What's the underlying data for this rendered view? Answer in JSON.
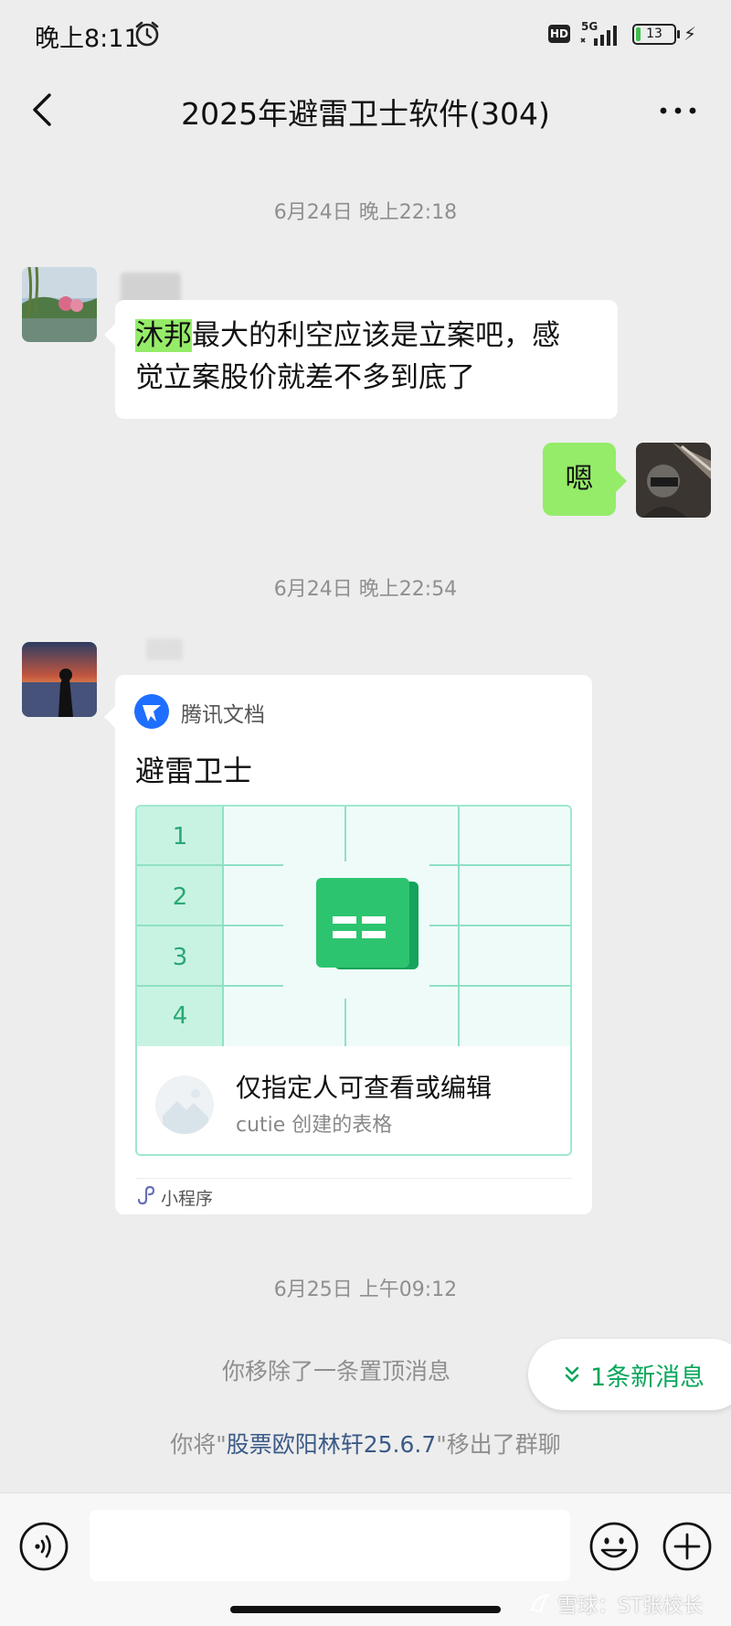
{
  "status_bar": {
    "time": "晚上8:11",
    "hd": "HD",
    "network": "5G",
    "battery_level": 13,
    "battery_text": "13"
  },
  "title_bar": {
    "title": "2025年避雷卫士软件(304)",
    "back_icon": "chevron-left-icon",
    "more_icon": "ellipsis-icon"
  },
  "messages": {
    "ts1": "6月24日 晚上22:18",
    "msg1": {
      "mention": "沐邦",
      "line1_rest": "最大的利空应该是立案吧，感",
      "line2": "觉立案股价就差不多到底了"
    },
    "msg2": {
      "text": "嗯"
    },
    "ts2": "6月24日 晚上22:54",
    "card": {
      "source": "腾讯文档",
      "title": "避雷卫士",
      "rows": [
        "1",
        "2",
        "3",
        "4"
      ],
      "access": "仅指定人可查看或编辑",
      "creator": "cutie 创建的表格",
      "footer": "小程序"
    },
    "ts3": "6月25日 上午09:12",
    "sys1": "你移除了一条置顶消息",
    "sys2": {
      "prefix": "你将\"",
      "name": "股票欧阳林轩25.6.7",
      "suffix": "\"移出了群聊"
    }
  },
  "new_messages_pill": "1条新消息",
  "input_bar": {
    "voice_icon": "voice-icon",
    "emoji_icon": "smiley-icon",
    "plus_icon": "plus-icon",
    "value": ""
  },
  "watermark": "雪球：ST张校长",
  "colors": {
    "background": "#ededed",
    "self_bubble": "#95ec69",
    "accent_green": "#07a65b",
    "link_blue": "#3b5a87"
  }
}
